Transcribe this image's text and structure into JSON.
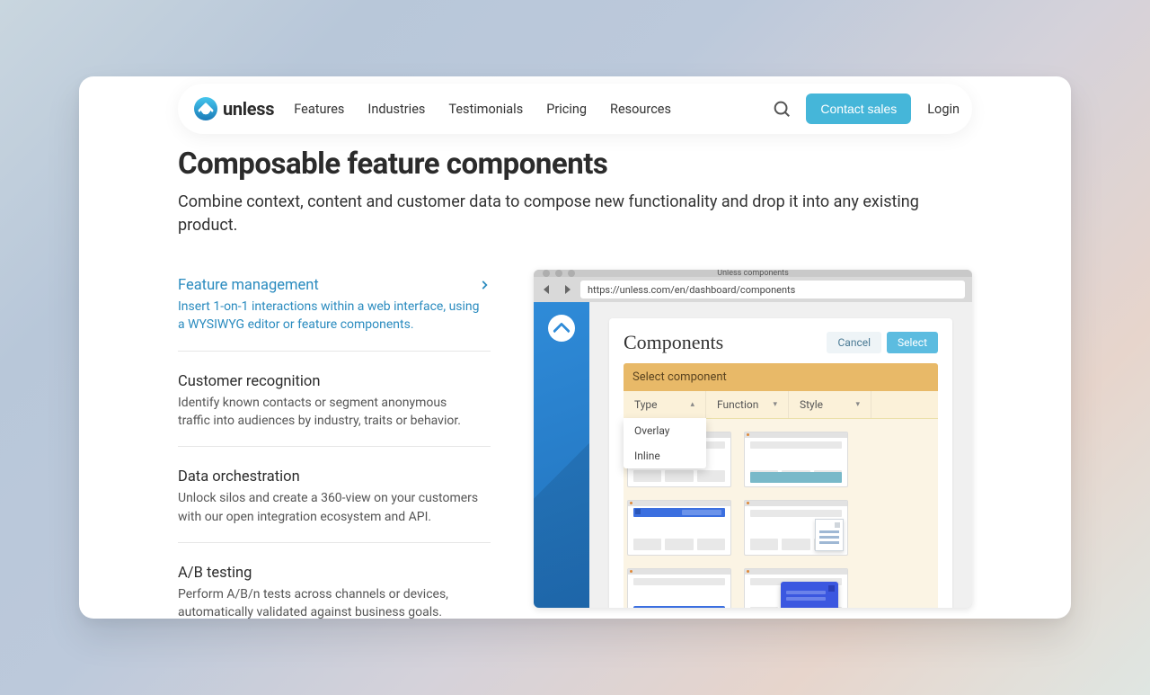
{
  "brand": {
    "name": "unless"
  },
  "nav": {
    "links": [
      "Features",
      "Industries",
      "Testimonials",
      "Pricing",
      "Resources"
    ],
    "cta": "Contact sales",
    "login": "Login"
  },
  "hero": {
    "title": "Composable feature components",
    "subtitle": "Combine context, content and customer data to compose new functionality and drop it into any existing product."
  },
  "features": [
    {
      "title": "Feature management",
      "desc": "Insert 1-on-1 interactions within a web interface, using a WYSIWYG editor or feature components.",
      "active": true
    },
    {
      "title": "Customer recognition",
      "desc": "Identify known contacts or segment anonymous traffic into audiences by industry, traits or behavior.",
      "active": false
    },
    {
      "title": "Data orchestration",
      "desc": "Unlock silos and create a 360-view on your customers with our open integration ecosystem and API.",
      "active": false
    },
    {
      "title": "A/B testing",
      "desc": "Perform A/B/n tests across channels or devices, automatically validated against business goals.",
      "active": false
    }
  ],
  "browser": {
    "window_title": "Unless components",
    "url": "https://unless.com/en/dashboard/components",
    "panel_title": "Components",
    "cancel": "Cancel",
    "select": "Select",
    "select_header": "Select component",
    "filters": {
      "type": "Type",
      "function": "Function",
      "style": "Style"
    },
    "type_options": [
      "Overlay",
      "Inline"
    ]
  }
}
